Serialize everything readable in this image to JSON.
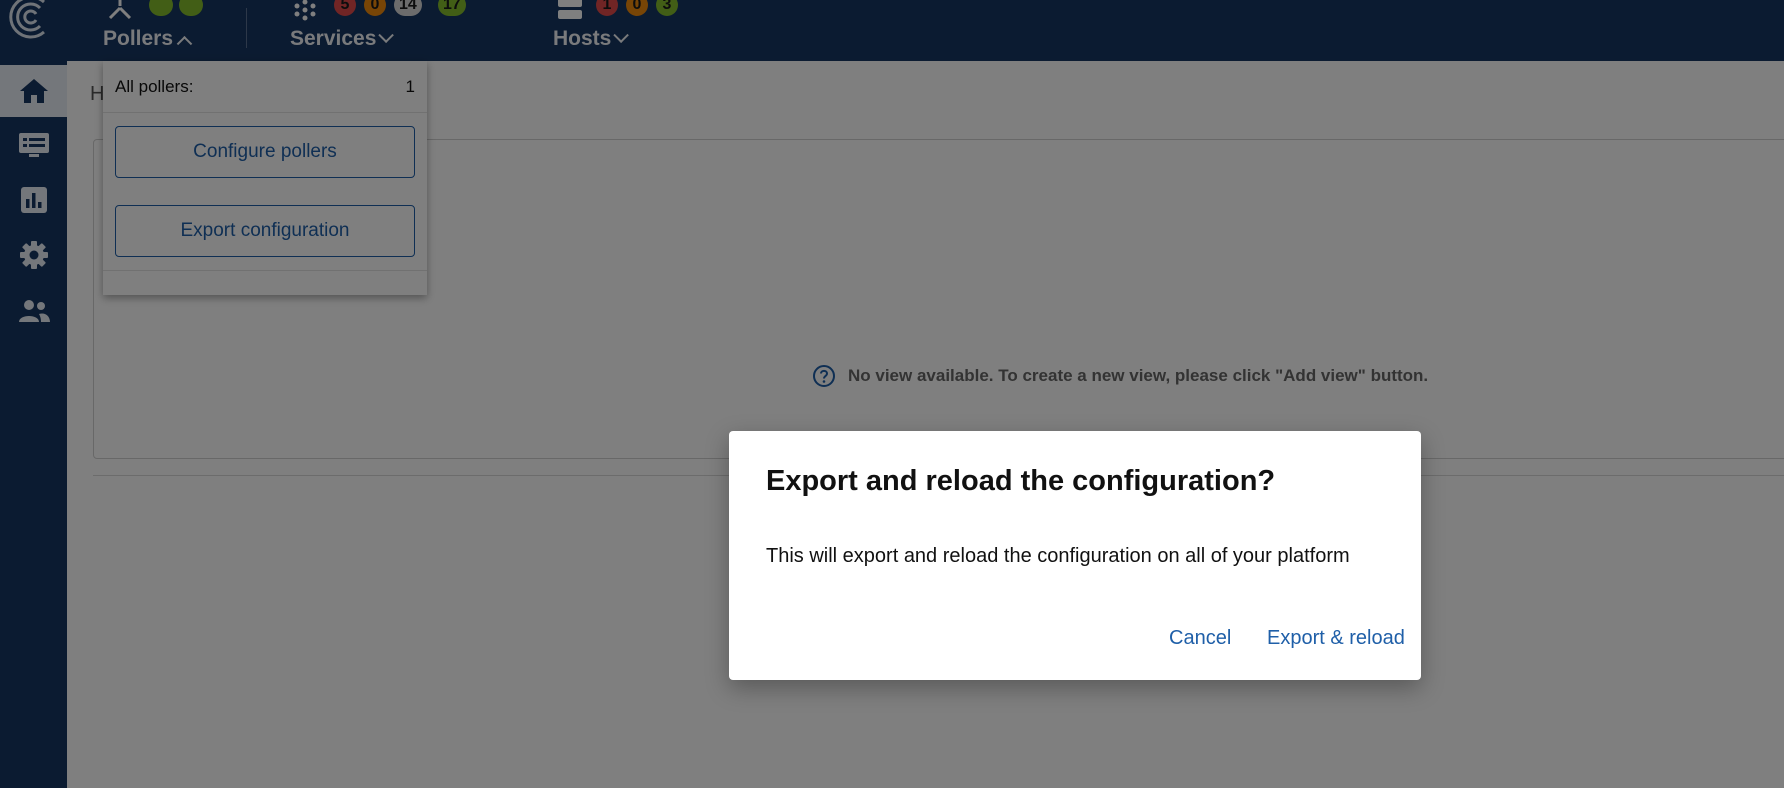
{
  "header": {
    "pollers": {
      "label": "Pollers"
    },
    "services": {
      "label": "Services",
      "counts": [
        "5",
        "0",
        "14",
        "17"
      ]
    },
    "hosts": {
      "label": "Hosts",
      "counts": [
        "1",
        "0",
        "3"
      ]
    },
    "colors": {
      "bar": "#173762",
      "critical": "#e24a4a",
      "warning": "#f08a0c",
      "unknown": "#d9d9d9",
      "ok": "#84bd2c"
    }
  },
  "sidebar": {
    "items": [
      {
        "icon": "home-icon",
        "active": true
      },
      {
        "icon": "monitoring-icon"
      },
      {
        "icon": "reporting-icon"
      },
      {
        "icon": "configuration-icon"
      },
      {
        "icon": "administration-icon"
      }
    ]
  },
  "main": {
    "breadcrumb": "H",
    "empty_message": "No view available. To create a new view, please click \"Add view\" button."
  },
  "dropdown": {
    "all_pollers_label": "All pollers:",
    "all_pollers_count": "1",
    "configure_label": "Configure pollers",
    "export_label": "Export configuration"
  },
  "dialog": {
    "title": "Export and reload the configuration?",
    "body": "This will export and reload the configuration on all of your platform",
    "cancel_label": "Cancel",
    "confirm_label": "Export & reload"
  }
}
